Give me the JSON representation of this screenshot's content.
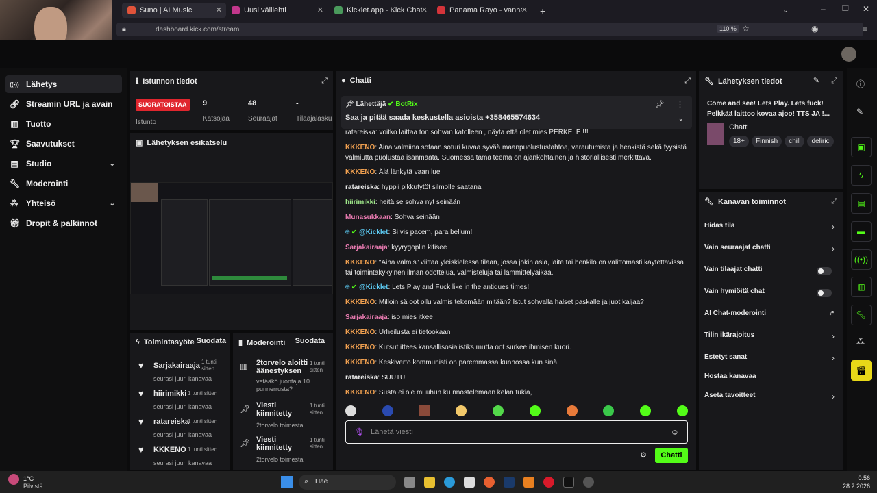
{
  "browser": {
    "tabs": [
      {
        "title": "Suno | AI Music",
        "color": "#e0533a"
      },
      {
        "title": "Uusi välilehti",
        "color": "#c2378c"
      },
      {
        "title": "Kicklet.app - Kick Chatbot and C",
        "color": "#4a9a5c"
      },
      {
        "title": "Panama Rayo - vanhat hyvät m",
        "color": "#d4343a"
      }
    ],
    "url": "dashboard.kick.com/stream",
    "zoom": "110 %"
  },
  "sidebar": {
    "items": [
      {
        "label": "Lähetys",
        "icon": "broadcast-icon"
      },
      {
        "label": "Streamin URL ja avain",
        "icon": "link-icon"
      },
      {
        "label": "Tuotto",
        "icon": "chart-icon"
      },
      {
        "label": "Saavutukset",
        "icon": "trophy-icon"
      },
      {
        "label": "Studio",
        "icon": "studio-icon"
      },
      {
        "label": "Moderointi",
        "icon": "wrench-icon"
      },
      {
        "label": "Yhteisö",
        "icon": "community-icon"
      },
      {
        "label": "Dropit & palkinnot",
        "icon": "gift-icon"
      }
    ]
  },
  "session": {
    "title": "Istunnon tiedot",
    "live": "SUORATOISTAA",
    "duration_label": "Istunto",
    "stats": [
      {
        "value": "9",
        "label": "Katsojaa"
      },
      {
        "value": "48",
        "label": "Seuraajat"
      },
      {
        "value": "-",
        "label": "Tilaajalasku"
      }
    ]
  },
  "preview": {
    "title": "Lähetyksen esikatselu"
  },
  "activity": {
    "title": "Toimintasyöte",
    "filter": "Suodata",
    "items": [
      {
        "user": "Sarjakairaaja",
        "time": "1 tunti sitten",
        "action": "seurasi juuri kanavaa"
      },
      {
        "user": "hiirimikki",
        "time": "1 tunti sitten",
        "action": "seurasi juuri kanavaa"
      },
      {
        "user": "ratareiska",
        "time": "1 tunti sitten",
        "action": "seurasi juuri kanavaa"
      },
      {
        "user": "KKKENO",
        "time": "1 tunti sitten",
        "action": "seurasi juuri kanavaa"
      }
    ]
  },
  "moderation": {
    "title": "Moderointi",
    "filter": "Suodata",
    "items": [
      {
        "title": "2torvelo aloitti äänestyksen",
        "time": "1 tunti sitten",
        "detail": "vetääkö juontaja 10 punnerrusta?"
      },
      {
        "title": "Viesti kiinnitetty",
        "time": "1 tunti sitten",
        "detail": "2torvelo toimesta"
      },
      {
        "title": "Viesti kiinnitetty",
        "time": "1 tunti sitten",
        "detail": "2torvelo toimesta"
      }
    ]
  },
  "chat": {
    "title": "Chatti",
    "pinned": {
      "sender": "Lähettäjä",
      "bot": "BotRix",
      "text": "Saa ja pitää saada keskustella asioista +358465574634"
    },
    "messages": [
      {
        "user": "KKKENO",
        "color": "or",
        "text": "Aina valmiina sotaan soturi kuvaa syvää maanpuolustustahtoa, varautumista ja henkistä sekä fyysistä valmiutta puolustaa isänmaata. Suomessa tämä teema on ajankohtainen ja historiallisesti merkittävä."
      },
      {
        "user": "KKKENO",
        "color": "or",
        "text": "Älä länkytä vaan lue"
      },
      {
        "user": "ratareiska",
        "color": "gy",
        "text": "hyppii pikkutytöt silmolle saatana"
      },
      {
        "user": "hiirimikki",
        "color": "gn",
        "text": "heitä se sohva nyt seinään"
      },
      {
        "user": "Munasukkaan",
        "color": "pk",
        "text": "Sohva seinään"
      },
      {
        "user": "@Kicklet",
        "color": "bt",
        "text": "Si vis pacem, para bellum!"
      },
      {
        "user": "Sarjakairaaja",
        "color": "pk",
        "text": "kyyrygoplin kitisee"
      },
      {
        "user": "KKKENO",
        "color": "or",
        "text": "\"Aina valmis\" viittaa yleiskielessä tilaan, jossa jokin asia, laite tai henkilö on välittömästi käytettävissä tai toimintakykyinen ilman odottelua, valmisteluja tai lämmittelyaikaa."
      },
      {
        "user": "@Kicklet",
        "color": "bt",
        "text": "Lets Play and Fuck like in the antiques times!"
      },
      {
        "user": "KKKENO",
        "color": "or",
        "text": "Milloin sä oot ollu valmis tekemään mitään? Istut sohvalla halset paskalle ja juot kaljaa?"
      },
      {
        "user": "Sarjakairaaja",
        "color": "pk",
        "text": "iso mies itkee"
      },
      {
        "user": "KKKENO",
        "color": "or",
        "text": "Urheilusta ei tietookaan"
      },
      {
        "user": "KKKENO",
        "color": "or",
        "text": "Kutsut ittees kansallisosialistiks mutta oot surkee ihmisen kuori."
      },
      {
        "user": "KKKENO",
        "color": "or",
        "text": "Keskiverto kommunisti on paremmassa kunnossa kun sinä."
      },
      {
        "user": "ratareiska",
        "color": "gy",
        "text": "SUUTU"
      },
      {
        "user": "KKKENO",
        "color": "or",
        "text": "Susta ei ole muuhun ku nnostelemaan kelan tukia,"
      }
    ],
    "partial_top": "ratareiska: voitko laittaa ton sohvan katolleen , näyta että olet mies PERKELE !!!",
    "input_placeholder": "Lähetä viesti",
    "send_label": "Chatti"
  },
  "stream_info": {
    "title": "Lähetyksen tiedot",
    "stream_title": "Come and see! Lets Play. Lets fuck! Pelkkää laittoo kovaa ajoo! TTS JA !...",
    "category": "Chatti",
    "tags": [
      "18+",
      "Finnish",
      "chill",
      "deliric"
    ]
  },
  "channel": {
    "title": "Kanavan toiminnot",
    "items": [
      {
        "label": "Hidas tila",
        "control": "chevron"
      },
      {
        "label": "Vain seuraajat chatti",
        "control": "chevron"
      },
      {
        "label": "Vain tilaajat chatti",
        "control": "toggle"
      },
      {
        "label": "Vain hymiöitä chat",
        "control": "toggle"
      },
      {
        "label": "AI Chat-moderointi",
        "control": "external"
      },
      {
        "label": "Tilin ikärajoitus",
        "control": "chevron"
      },
      {
        "label": "Estetyt sanat",
        "control": "chevron"
      },
      {
        "label": "Hostaa kanavaa",
        "control": "none"
      },
      {
        "label": "Aseta tavoitteet",
        "control": "chevron"
      }
    ]
  },
  "taskbar": {
    "temp": "1°C",
    "weather": "Pilvistä",
    "search": "Hae",
    "time": "0.56",
    "date": "28.2.2026"
  }
}
